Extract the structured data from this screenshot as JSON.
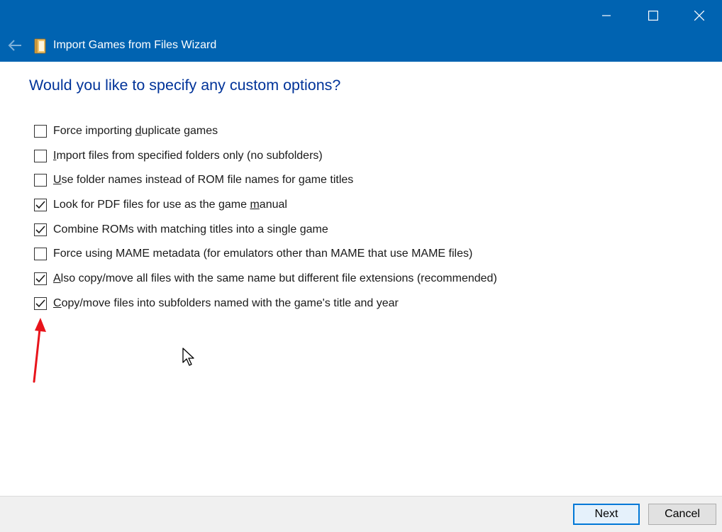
{
  "window": {
    "title": "Import Games from Files Wizard",
    "controls": {
      "minimize": "minimize-icon",
      "maximize": "maximize-icon",
      "close": "close-icon"
    },
    "back_icon": "back-arrow-icon",
    "app_icon": "wizard-book-icon"
  },
  "page": {
    "heading": "Would you like to specify any custom options?"
  },
  "options": [
    {
      "pre": "Force importing ",
      "ul": "d",
      "post": "uplicate games",
      "checked": false
    },
    {
      "pre": "",
      "ul": "I",
      "post": "mport files from specified folders only (no subfolders)",
      "checked": false
    },
    {
      "pre": "",
      "ul": "U",
      "post": "se folder names instead of ROM file names for game titles",
      "checked": false
    },
    {
      "pre": "Look for PDF files for use as the game ",
      "ul": "m",
      "post": "anual",
      "checked": true
    },
    {
      "pre": "Combine ROMs with matching titles into a single game",
      "ul": "",
      "post": "",
      "checked": true
    },
    {
      "pre": "Force using MAME metadata (for emulators other than MAME that use MAME files)",
      "ul": "",
      "post": "",
      "checked": false
    },
    {
      "pre": "",
      "ul": "A",
      "post": "lso copy/move all files with the same name but different file extensions (recommended)",
      "checked": true
    },
    {
      "pre": "",
      "ul": "C",
      "post": "opy/move files into subfolders named with the game's title and year",
      "checked": true
    }
  ],
  "footer": {
    "next_label": "Next",
    "cancel_label": "Cancel"
  },
  "colors": {
    "titlebar": "#0063b1",
    "heading": "#003399",
    "annotation_arrow": "#e8141b"
  }
}
